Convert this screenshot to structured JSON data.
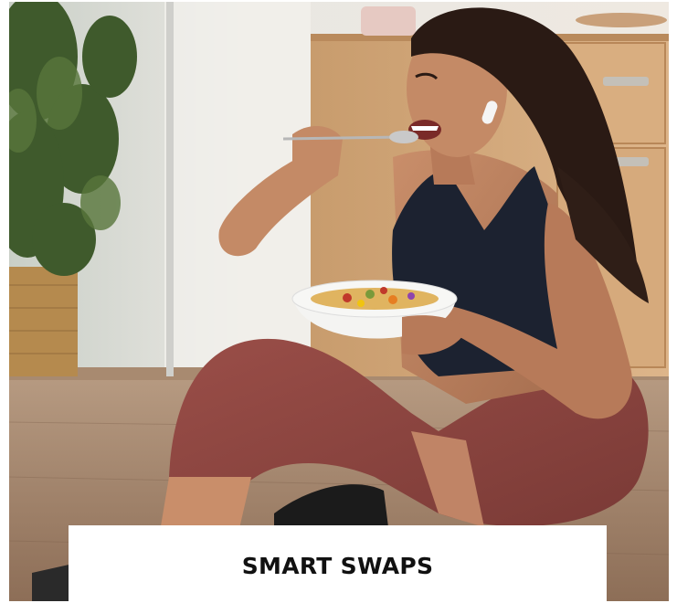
{
  "card": {
    "title": "SMART SWAPS",
    "image_subject": "woman-eating-bowl-photo"
  },
  "colors": {
    "caption_background": "#ffffff",
    "caption_text": "#111111"
  }
}
